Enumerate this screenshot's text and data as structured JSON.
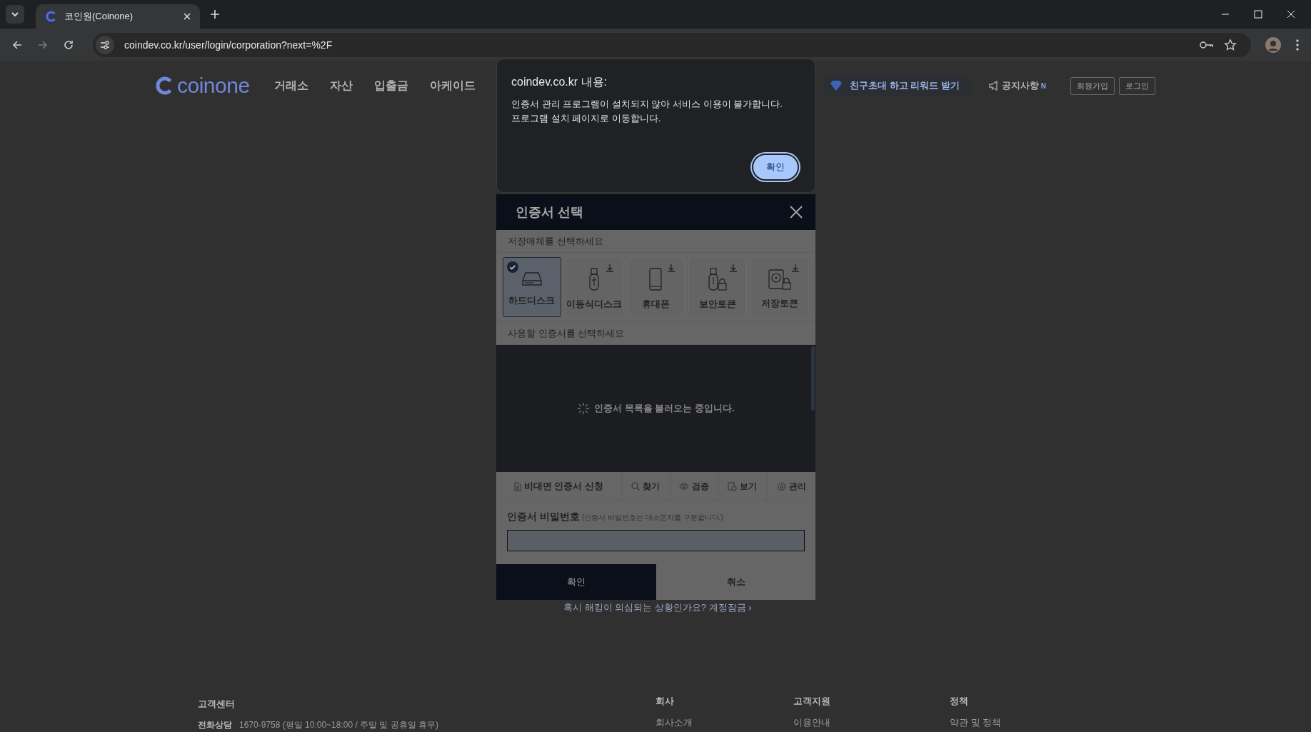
{
  "browser": {
    "tab_title": "코인원(Coinone)",
    "url": "coindev.co.kr/user/login/corporation?next=%2F"
  },
  "site_header": {
    "logo": "coinone",
    "nav": [
      "거래소",
      "자산",
      "입출금",
      "아케이드"
    ],
    "promo": "친구초대 하고 리워드 받기",
    "notice": "공지사항",
    "notice_badge": "N",
    "buttons": [
      "회원가입",
      "로그인"
    ]
  },
  "alert": {
    "title": "coindev.co.kr 내용:",
    "message_lines": [
      "인증서 관리 프로그램이 설치되지 않아 서비스 이용이 불가합니다.",
      "프로그램 설치 페이지로 이동합니다."
    ],
    "button": "확인"
  },
  "cert_modal": {
    "title": "인증서 선택",
    "media_label": "저장매체를 선택하세요",
    "media": [
      {
        "label": "하드디스크",
        "kind": "hdd",
        "selected": true
      },
      {
        "label": "이동식디스크",
        "kind": "usb",
        "selected": false
      },
      {
        "label": "휴대폰",
        "kind": "phone",
        "selected": false
      },
      {
        "label": "보안토큰",
        "kind": "usb_lock",
        "selected": false
      },
      {
        "label": "저장토큰",
        "kind": "disk_lock",
        "selected": false
      }
    ],
    "list_label": "사용할 인증서를 선택하세요",
    "loading": "인증서 목록을 불러오는 중입니다.",
    "actions": [
      {
        "label": "비대면 인증서 신청",
        "kind": "doc"
      },
      {
        "label": "찾기",
        "kind": "search"
      },
      {
        "label": "검증",
        "kind": "eye"
      },
      {
        "label": "보기",
        "kind": "cert"
      },
      {
        "label": "관리",
        "kind": "gear"
      }
    ],
    "password_label": "인증서 비밀번호",
    "password_hint": "(인증서 비밀번호는 대소문자를 구분합니다.)",
    "confirm": "확인",
    "cancel": "취소"
  },
  "below_modal_link": "혹시 해킹이 의심되는 상황인가요? 계정잠금 ›",
  "footer": {
    "support_title": "고객센터",
    "phone_label": "전화상담",
    "phone_text": "1670-9758 (평일 10:00~18:00 / 주말 및 공휴일 휴무)",
    "columns": [
      {
        "title": "회사",
        "link": "회사소개"
      },
      {
        "title": "고객지원",
        "link": "이용안내"
      },
      {
        "title": "정책",
        "link": "약관 및 정책"
      }
    ]
  }
}
